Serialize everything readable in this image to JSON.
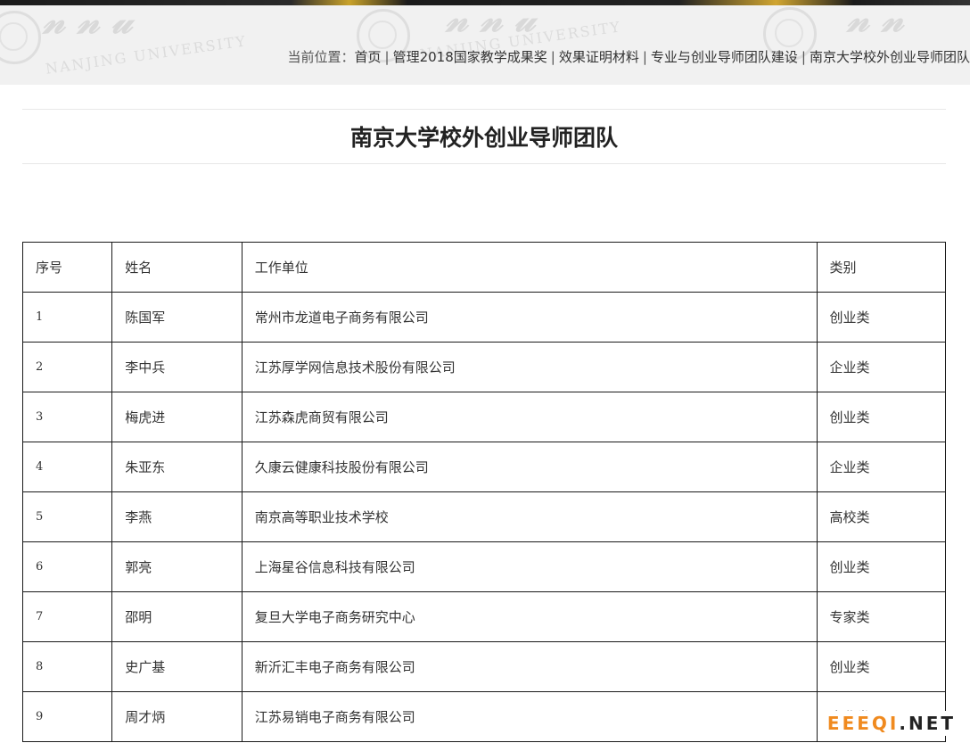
{
  "header": {
    "watermark_text": "NANJING UNIVERSITY"
  },
  "breadcrumb": {
    "prefix": "当前位置：",
    "items": [
      "首页",
      "管理2018国家教学成果奖",
      "效果证明材料",
      "专业与创业导师团队建设",
      "南京大学校外创业导师团队"
    ],
    "separator": "|"
  },
  "page": {
    "title": "南京大学校外创业导师团队"
  },
  "table": {
    "headers": [
      "序号",
      "姓名",
      "工作单位",
      "类别"
    ],
    "rows": [
      [
        "1",
        "陈国军",
        "常州市龙道电子商务有限公司",
        "创业类"
      ],
      [
        "2",
        "李中兵",
        "江苏厚学网信息技术股份有限公司",
        "企业类"
      ],
      [
        "3",
        "梅虎进",
        "江苏森虎商贸有限公司",
        "创业类"
      ],
      [
        "4",
        "朱亚东",
        "久康云健康科技股份有限公司",
        "企业类"
      ],
      [
        "5",
        "李燕",
        "南京高等职业技术学校",
        "高校类"
      ],
      [
        "6",
        "郭亮",
        "上海星谷信息科技有限公司",
        "创业类"
      ],
      [
        "7",
        "邵明",
        "复旦大学电子商务研究中心",
        "专家类"
      ],
      [
        "8",
        "史广基",
        "新沂汇丰电子商务有限公司",
        "创业类"
      ],
      [
        "9",
        "周才炳",
        "江苏易销电子商务有限公司",
        "企业类"
      ]
    ]
  },
  "brand": {
    "part1": "EEEQI",
    "part2": ".NET"
  }
}
